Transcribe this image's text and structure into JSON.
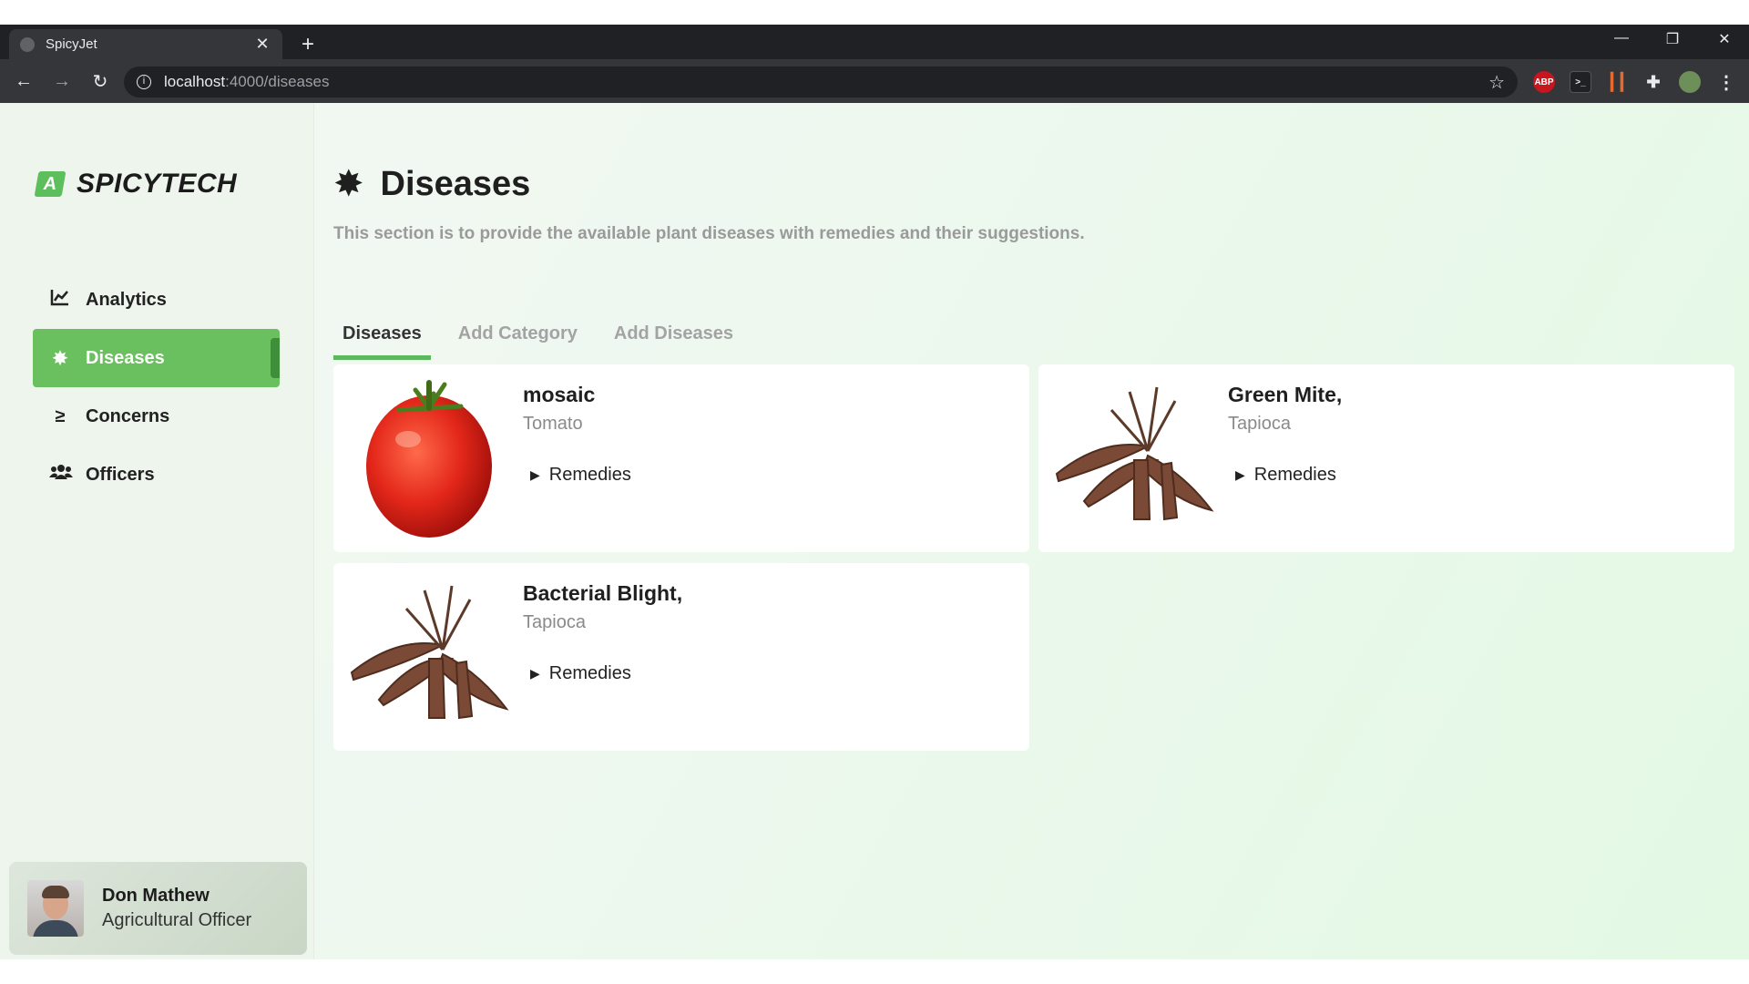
{
  "browser": {
    "tab_title": "SpicyJet",
    "url_host": "localhost",
    "url_path": ":4000/diseases",
    "extension_abp": "ABP",
    "extension_console": ">_"
  },
  "brand": {
    "logo_letter": "A",
    "name": "SPICYTECH",
    "accent_color": "#6abf5e"
  },
  "sidebar": {
    "items": [
      {
        "label": "Analytics",
        "icon": "chart-line-icon",
        "active": false
      },
      {
        "label": "Diseases",
        "icon": "virus-icon",
        "active": true
      },
      {
        "label": "Concerns",
        "icon": "greater-equal-icon",
        "active": false
      },
      {
        "label": "Officers",
        "icon": "users-icon",
        "active": false
      }
    ]
  },
  "profile": {
    "name": "Don Mathew",
    "role": "Agricultural Officer"
  },
  "page": {
    "title": "Diseases",
    "subtitle": "This section is to provide the available plant diseases with remedies and their suggestions."
  },
  "tabs": [
    {
      "label": "Diseases",
      "active": true
    },
    {
      "label": "Add Category",
      "active": false
    },
    {
      "label": "Add Diseases",
      "active": false
    }
  ],
  "cards": [
    {
      "name": "mosaic",
      "crop": "Tomato",
      "action": "Remedies",
      "image": "tomato-image"
    },
    {
      "name": "Green Mite,",
      "crop": "Tapioca",
      "action": "Remedies",
      "image": "tapioca-image"
    },
    {
      "name": "Bacterial Blight,",
      "crop": "Tapioca",
      "action": "Remedies",
      "image": "tapioca-image"
    }
  ]
}
